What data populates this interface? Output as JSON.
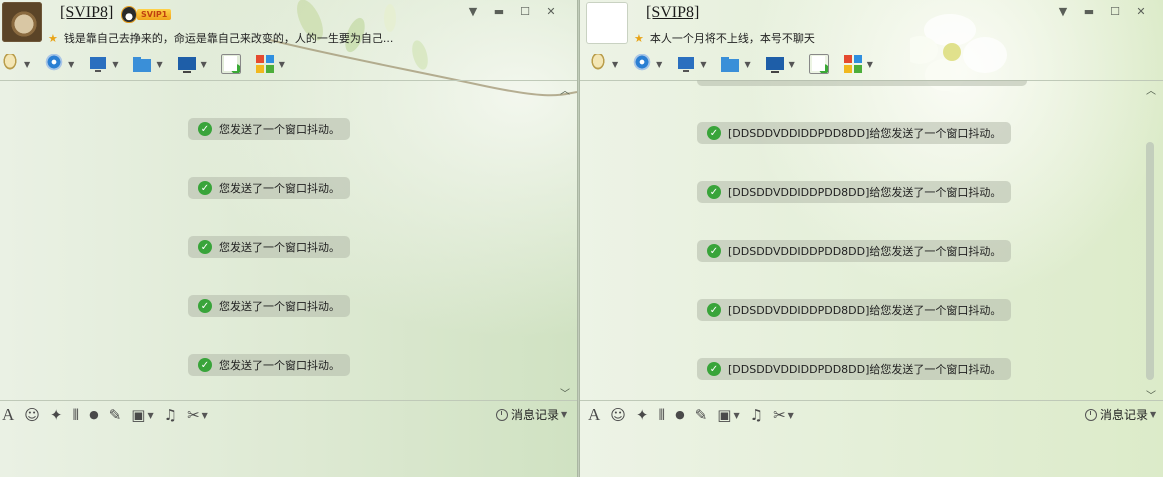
{
  "left_window": {
    "nickname": "[SVIP8]",
    "vip_badge": "SVIP1",
    "signature": "钱是靠自己去挣来的，命运是靠自己来改变的，人的一生要为自己...",
    "messages": [
      "您发送了一个窗口抖动。",
      "您发送了一个窗口抖动。",
      "您发送了一个窗口抖动。",
      "您发送了一个窗口抖动。",
      "您发送了一个窗口抖动。"
    ],
    "history_label": "消息记录"
  },
  "right_window": {
    "nickname": "[SVIP8]",
    "signature": "本人一个月将不上线，本号不聊天",
    "messages": [
      "[DDSDDVDDIDDPDD8DD]给您发送了一个窗口抖动。",
      "[DDSDDVDDIDDPDD8DD]给您发送了一个窗口抖动。",
      "[DDSDDVDDIDDPDD8DD]给您发送了一个窗口抖动。",
      "[DDSDDVDDIDDPDD8DD]给您发送了一个窗口抖动。",
      "[DDSDDVDDIDDPDD8DD]给您发送了一个窗口抖动。"
    ],
    "history_label": "消息记录"
  },
  "toolbar_icons": [
    "microphone-icon",
    "video-call-icon",
    "screen-share-icon",
    "file-transfer-icon",
    "remote-desktop-icon",
    "add-member-icon",
    "apps-icon"
  ],
  "input_toolbar_glyphs": {
    "font": "A",
    "emoji": "☺",
    "shake": "✦",
    "screenshot": "⦀",
    "voice": "●",
    "edit": "✎",
    "image": "▣",
    "music": "♫",
    "cut": "✂"
  },
  "window_controls": {
    "minimize": "▼",
    "restore": "▬",
    "maximize": "☐",
    "close": "✕"
  },
  "colors": {
    "notice_bg": "#b2baaa",
    "check": "#39a43a",
    "vip_gold": "#f0a31c"
  }
}
